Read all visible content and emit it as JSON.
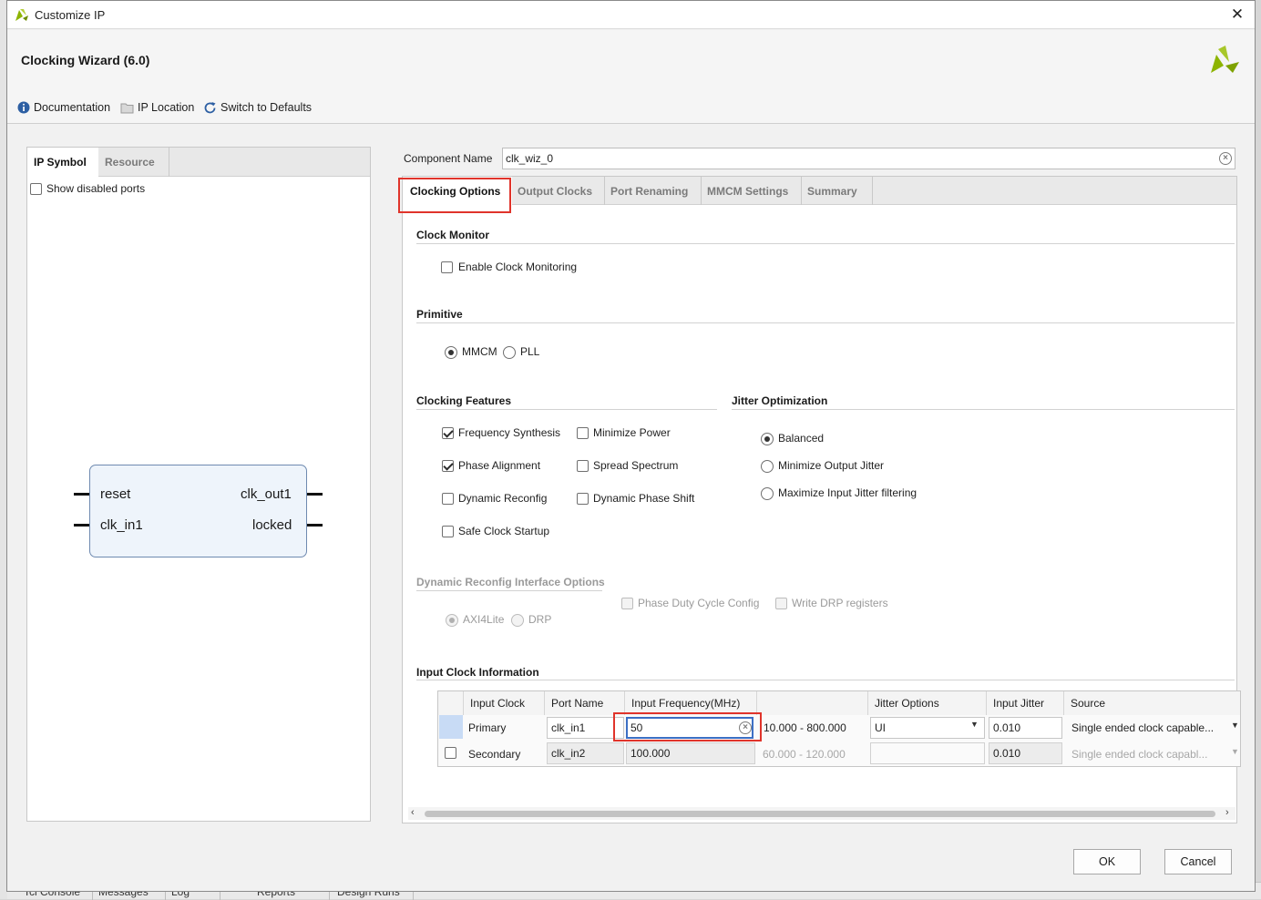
{
  "window": {
    "title": "Customize IP",
    "close_glyph": "✕"
  },
  "header": {
    "title": "Clocking Wizard (6.0)",
    "toolbar": [
      {
        "label": "Documentation",
        "icon": "info-icon"
      },
      {
        "label": "IP Location",
        "icon": "folder-icon"
      },
      {
        "label": "Switch to Defaults",
        "icon": "refresh-icon"
      }
    ],
    "brand_color": "#8db400"
  },
  "left_panel": {
    "tabs": [
      "IP Symbol",
      "Resource"
    ],
    "show_disabled_ports": "Show disabled ports",
    "symbol": {
      "inputs": [
        "reset",
        "clk_in1"
      ],
      "outputs": [
        "clk_out1",
        "locked"
      ]
    }
  },
  "component": {
    "label": "Component Name",
    "value": "clk_wiz_0"
  },
  "tabs": [
    "Clocking Options",
    "Output Clocks",
    "Port Renaming",
    "MMCM Settings",
    "Summary"
  ],
  "clock_monitor": {
    "title": "Clock Monitor",
    "enable": "Enable Clock Monitoring"
  },
  "primitive": {
    "title": "Primitive",
    "options": [
      "MMCM",
      "PLL"
    ],
    "selected": "MMCM"
  },
  "clocking_features": {
    "title": "Clocking Features",
    "items": [
      {
        "label": "Frequency Synthesis",
        "checked": true
      },
      {
        "label": "Minimize Power",
        "checked": false
      },
      {
        "label": "Phase Alignment",
        "checked": true
      },
      {
        "label": "Spread Spectrum",
        "checked": false
      },
      {
        "label": "Dynamic Reconfig",
        "checked": false
      },
      {
        "label": "Dynamic Phase Shift",
        "checked": false
      },
      {
        "label": "Safe Clock Startup",
        "checked": false
      }
    ]
  },
  "jitter_optimization": {
    "title": "Jitter Optimization",
    "options": [
      "Balanced",
      "Minimize Output Jitter",
      "Maximize Input Jitter filtering"
    ],
    "selected": "Balanced"
  },
  "dynamic_reconfig": {
    "title": "Dynamic Reconfig Interface Options",
    "options": [
      "AXI4Lite",
      "DRP"
    ],
    "checks": [
      "Phase Duty Cycle Config",
      "Write DRP registers"
    ]
  },
  "input_clock": {
    "title": "Input Clock Information",
    "headers": [
      "Input Clock",
      "Port Name",
      "Input Frequency(MHz)",
      "",
      "Jitter Options",
      "Input Jitter",
      "Source"
    ],
    "rows": [
      {
        "clock": "Primary",
        "port": "clk_in1",
        "freq": "50",
        "range": "10.000 - 800.000",
        "jitter_opt": "UI",
        "jitter": "0.010",
        "source": "Single ended clock capable..."
      },
      {
        "clock": "Secondary",
        "port": "clk_in2",
        "freq": "100.000",
        "range": "60.000 - 120.000",
        "jitter_opt": "",
        "jitter": "0.010",
        "source": "Single ended clock capabl..."
      }
    ]
  },
  "buttons": {
    "ok": "OK",
    "cancel": "Cancel"
  },
  "background_tabs": [
    "Tcl Console",
    "Messages",
    "Log",
    "Reports",
    "Design Runs"
  ]
}
